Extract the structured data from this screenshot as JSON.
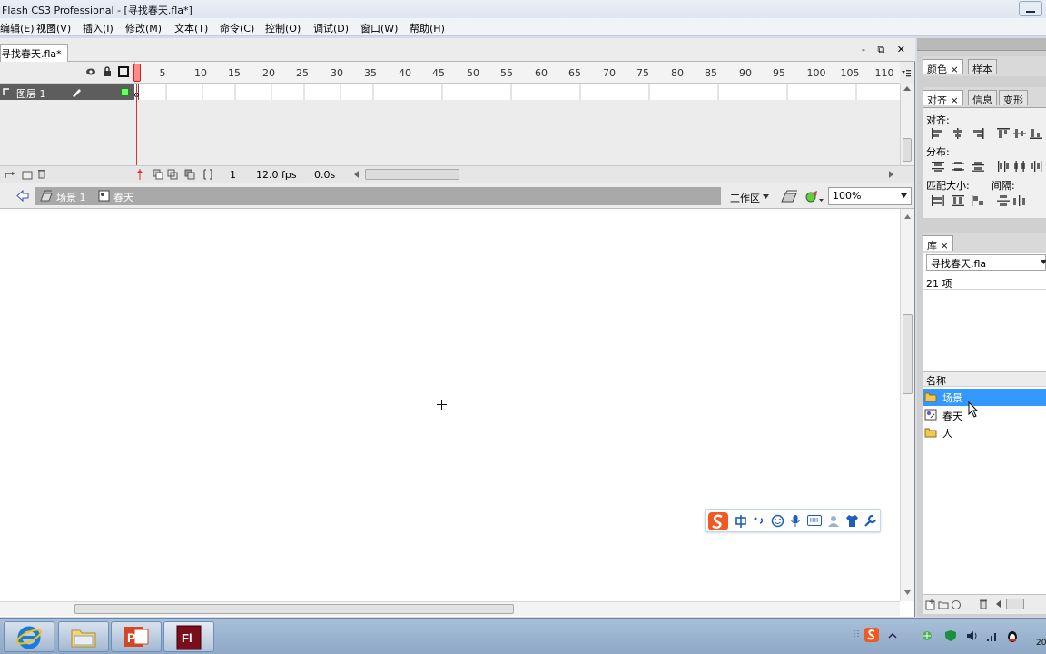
{
  "window": {
    "title": "Flash CS3 Professional - [寻找春天.fla*]"
  },
  "menu": [
    "编辑(E)",
    "视图(V)",
    "插入(I)",
    "修改(M)",
    "文本(T)",
    "命令(C)",
    "控制(O)",
    "调试(D)",
    "窗口(W)",
    "帮助(H)"
  ],
  "document": {
    "tab_label": "寻找春天.fla*",
    "window_controls": "- ⧉ ✕"
  },
  "timeline": {
    "frame_numbers": [
      "5",
      "10",
      "15",
      "20",
      "25",
      "30",
      "35",
      "40",
      "45",
      "50",
      "55",
      "60",
      "65",
      "70",
      "75",
      "80",
      "85",
      "90",
      "95",
      "100",
      "105",
      "110"
    ],
    "layer_name": "图层 1",
    "current_frame": "1",
    "fps": "12.0 fps",
    "elapsed": "0.0s"
  },
  "editbar": {
    "scene_label": "场景 1",
    "symbol_label": "春天",
    "workspace_label": "工作区",
    "zoom": "100%"
  },
  "panels": {
    "color_tabs": [
      "颜色",
      "样本"
    ],
    "align_tabs": [
      "对齐",
      "信息",
      "变形"
    ],
    "align": {
      "align_label": "对齐:",
      "distribute_label": "分布:",
      "match_size_label": "匹配大小:",
      "spacing_label": "间隔:"
    },
    "library": {
      "tab": "库",
      "document": "寻找春天.fla",
      "count": "21 项",
      "column_name": "名称",
      "items": [
        {
          "name": "场景",
          "icon": "folder-icon",
          "selected": true
        },
        {
          "name": "春天",
          "icon": "movieclip-symbol-icon",
          "selected": false
        },
        {
          "name": "人",
          "icon": "folder-icon",
          "selected": false
        }
      ]
    }
  },
  "taskbar": {
    "buttons": [
      "ie-browser-icon",
      "file-explorer-icon",
      "powerpoint-icon",
      "flash-icon"
    ],
    "clock_partial": "20"
  },
  "colors": {
    "selection": "#3399ff",
    "layer_row": "#5d5d5d",
    "playhead": "#e03030",
    "stage": "#ffffff"
  }
}
